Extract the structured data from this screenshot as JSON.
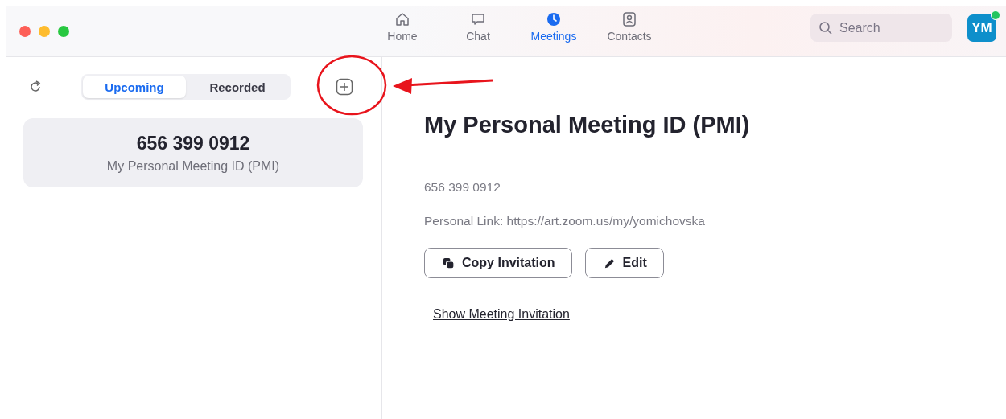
{
  "nav_tabs": [
    {
      "label": "Home",
      "kind": "home",
      "selected": false
    },
    {
      "label": "Chat",
      "kind": "chat",
      "selected": false
    },
    {
      "label": "Meetings",
      "kind": "clock",
      "selected": true
    },
    {
      "label": "Contacts",
      "kind": "contact",
      "selected": false
    }
  ],
  "search": {
    "placeholder": "Search"
  },
  "avatar": {
    "initials": "YM"
  },
  "segments": [
    {
      "label": "Upcoming",
      "selected": true
    },
    {
      "label": "Recorded",
      "selected": false
    }
  ],
  "meetings": [
    {
      "number": "656 399 0912",
      "title": "My Personal Meeting ID (PMI)",
      "selected": true
    }
  ],
  "detail": {
    "title": "My Personal Meeting ID (PMI)",
    "number": "656 399 0912",
    "link": "Personal Link: https://art.zoom.us/my/yomichovska",
    "buttons": [
      {
        "label": "Copy Invitation",
        "kind": "copy"
      },
      {
        "label": "Edit",
        "kind": "edit"
      }
    ],
    "show_link": "Show Meeting Invitation"
  }
}
